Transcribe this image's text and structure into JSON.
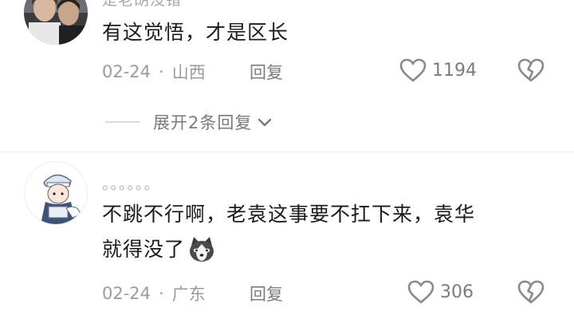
{
  "comments": [
    {
      "username": "是老胡没错",
      "text": "有这觉悟，才是区长",
      "date": "02-24",
      "location": "山西",
      "reply_label": "回复",
      "likes": "1194"
    },
    {
      "username": "。。。。。。",
      "text_line1": "不跳不行啊，老袁这事要不扛下来，袁华",
      "text_line2": "就得没了",
      "emoji_icon": "husky-emoji-icon",
      "date": "02-24",
      "location": "广东",
      "reply_label": "回复",
      "likes": "306"
    }
  ],
  "expand_replies": {
    "label": "展开2条回复"
  },
  "separator": "·",
  "colors": {
    "text_primary": "#1b1b1b",
    "text_secondary": "#9b9b9b",
    "icon": "#8a8a8a"
  }
}
